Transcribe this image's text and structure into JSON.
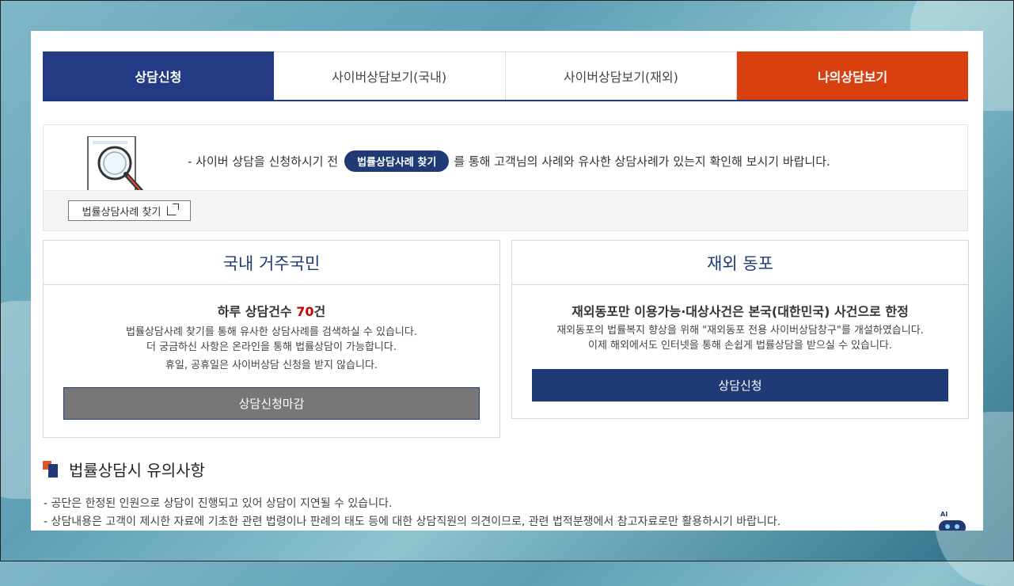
{
  "tabs": [
    {
      "label": "상담신청"
    },
    {
      "label": "사이버상담보기(국내)"
    },
    {
      "label": "사이버상담보기(재외)"
    },
    {
      "label": "나의상담보기"
    }
  ],
  "notice": {
    "text_before": "- 사이버 상담을 신청하시기 전",
    "pill_label": "법률상담사례 찾기",
    "text_after": "를 통해 고객님의 사례와 유사한 상담사례가 있는지 확인해 보시기 바랍니다.",
    "button_label": "법률상담사례 찾기"
  },
  "domestic": {
    "title": "국내 거주국민",
    "limit_prefix": "하루 상담건수",
    "limit_count": "70",
    "limit_suffix": "건",
    "line1": "법률상담사례 찾기를 통해 유사한 상담사례를 검색하실 수 있습니다.",
    "line2": "더 궁금하신 사항은 온라인을 통해 법률상담이 가능합니다.",
    "line3": "휴일, 공휴일은 사이버상담 신청을 받지 않습니다.",
    "button_label": "상담신청마감"
  },
  "overseas": {
    "title": "재외 동포",
    "subtitle": "재외동포만 이용가능·대상사건은 본국(대한민국) 사건으로 한정",
    "line1": "재외동포의 법률복지 향상을 위해 \"재외동포 전용 사이버상담창구\"를 개설하였습니다.",
    "line2": "이제 해외에서도 인터넷을 통해 손쉽게 법률상담을 받으실 수 있습니다.",
    "button_label": "상담신청"
  },
  "caution": {
    "title": "법률상담시 유의사항",
    "items": [
      "- 공단은 한정된 인원으로 상담이 진행되고 있어 상담이 지연될 수 있습니다.",
      "- 상담내용은 고객이 제시한 자료에 기초한 관련 법령이나 판례의 태도 등에 대한 상담직원의 의견이므로, 관련 법적분쟁에서 참고자료로만 활용하시기 바랍니다."
    ]
  },
  "ai_badge": {
    "label": "AI"
  },
  "colors": {
    "navy": "#253a85",
    "orange": "#d9400f",
    "red": "#cc0000"
  }
}
